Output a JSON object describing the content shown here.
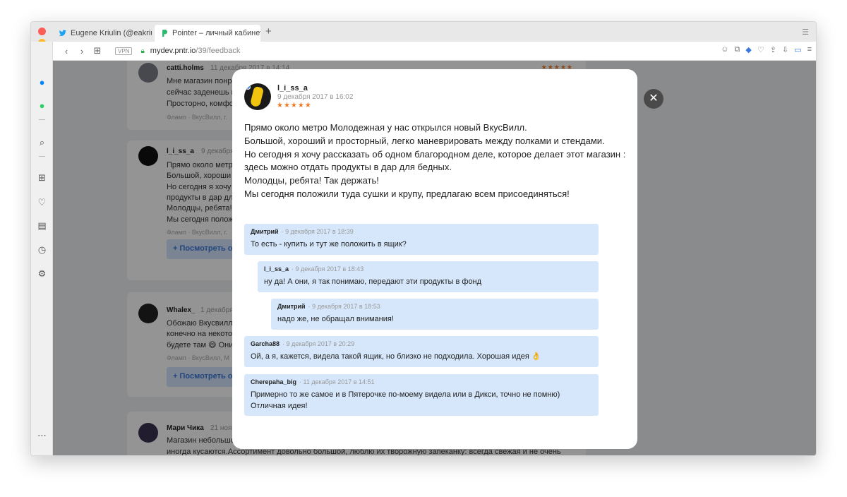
{
  "browser": {
    "tabs": [
      {
        "label": "Eugene Kriulin (@eakriulin) /"
      },
      {
        "label": "Pointer – личный кабинет"
      }
    ],
    "new_tab": "+",
    "vpn_label": "VPN",
    "url_host": "mydev.pntr.io",
    "url_path": "/39/feedback"
  },
  "background_feed": [
    {
      "author": "catti.holms",
      "date": "11 декабря 2017 в 14:14",
      "lines": [
        "Мне магазин понр",
        "сейчас заденешь и",
        "Просторно, комфо"
      ],
      "meta": "Фламп · ВкусВилл, г."
    },
    {
      "author": "l_i_ss_a",
      "date": "9 декабря 2",
      "lines": [
        "Прямо около метр",
        "Большой, хороши",
        "Но сегодня я хочу",
        "продукты в дар дл",
        "Молодцы, ребята!",
        "Мы сегодня полож"
      ],
      "meta": "Фламп · ВкусВилл, г.",
      "more_label": "+ Посмотреть от"
    },
    {
      "author": "Whalex_",
      "date": "1 декабря",
      "lines": [
        "Обожаю Вкусвилл",
        "конечно на некото",
        "будете там 😄 Они"
      ],
      "meta": "Фламп · ВкусВилл, М",
      "more_label": "+ Посмотреть от"
    },
    {
      "author": "Мари Чика",
      "date": "21 нояб",
      "lines": [
        "Магазин небольшо",
        "иногда кусаются.Ассортимент довольно большой, люблю их творожную запеканку: всегда свежая и не очень"
      ]
    }
  ],
  "modal": {
    "author": "l_i_ss_a",
    "date": "9 декабря 2017 в 16:02",
    "rating": "★★★★★",
    "body_lines": [
      "Прямо около метро Молодежная у нас открылся новый ВкусВилл.",
      "Большой, хороший и просторный, легко маневрировать между полками и стендами.",
      "Но сегодня я хочу рассказать об одном благородном деле, которое делает этот магазин :",
      "здесь можно отдать продукты в дар для бедных.",
      "Молодцы, ребята! Так держать!",
      "Мы сегодня положили туда сушки и крупу, предлагаю всем присоединяться!"
    ],
    "comments": [
      {
        "name": "Дмитрий",
        "date": "9 декабря 2017 в 18:39",
        "text": "То есть - купить и тут же положить в ящик?"
      },
      {
        "name": "l_i_ss_a",
        "date": "9 декабря 2017 в 18:43",
        "text": "ну да! А они, я так понимаю, передают эти продукты в фонд"
      },
      {
        "name": "Дмитрий",
        "date": "9 декабря 2017 в 18:53",
        "text": "надо же, не обращал внимания!"
      },
      {
        "name": "Garcha88",
        "date": "9 декабря 2017 в 20:29",
        "text": "Ой, а я, кажется, видела такой ящик, но близко не подходила. Хорошая идея 👌"
      },
      {
        "name": "Cherepaha_big",
        "date": "11 декабря 2017 в 14:51",
        "text": "Примерно то же самое и в Пятерочке по-моему видела или в Дикси, точно не помню)",
        "text2": "Отличная идея!"
      }
    ],
    "close": "✕"
  }
}
